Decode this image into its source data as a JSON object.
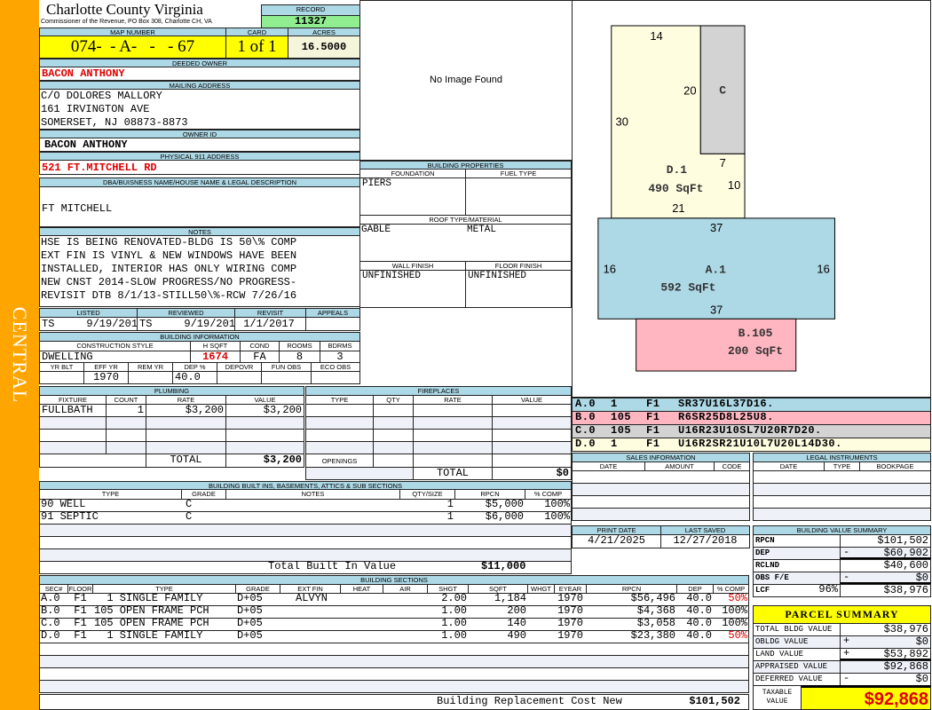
{
  "sidebar_label": "CENTRAL",
  "header": {
    "county": "Charlotte County Virginia",
    "subtitle": "Commissioner of the Revenue, PO Box 308, Charlotte CH, VA",
    "record_label": "RECORD",
    "record": "11327"
  },
  "parcel": {
    "map_number_label": "MAP NUMBER",
    "map_number": "074-  - A-   -   - 67",
    "card_label": "CARD",
    "card": "1 of 1",
    "acres_label": "ACRES",
    "acres": "16.5000"
  },
  "owner": {
    "deeded_label": "DEEDED OWNER",
    "deeded": "BACON ANTHONY",
    "mailing_label": "MAILING ADDRESS",
    "mailing": [
      "C/O DOLORES MALLORY",
      "161 IRVINGTON AVE",
      "SOMERSET, NJ 08873-8873"
    ],
    "owner_id_label": "OWNER ID",
    "owner_id": "BACON ANTHONY",
    "physical_label": "PHYSICAL 911 ADDRESS",
    "physical": "521 FT.MITCHELL RD"
  },
  "dba": {
    "label": "DBA/BUISNESS NAME/HOUSE NAME & LEGAL DESCRIPTION",
    "value": "FT MITCHELL"
  },
  "notes": {
    "label": "NOTES",
    "lines": [
      "HSE IS BEING RENOVATED-BLDG IS 50\\% COMP",
      "EXT FIN IS VINYL & NEW WINDOWS HAVE BEEN",
      "INSTALLED, INTERIOR HAS ONLY WIRING COMP",
      "NEW CNST 2014-SLOW PROGRESS/NO PROGRESS-",
      "REVISIT DTB 8/1/13-STILL50\\%-RCW 7/26/16"
    ]
  },
  "review": {
    "headers": [
      "LISTED",
      "REVIEWED",
      "REVISIT",
      "APPEALS"
    ],
    "values": [
      "TS     9/19/2018",
      "TS     9/19/2018",
      " 1/1/2017",
      ""
    ]
  },
  "building_info": {
    "label": "BUILDING INFORMATION",
    "headers1": [
      "CONSTRUCTION STYLE",
      "H SQFT",
      "COND",
      "ROOMS",
      "BDRMS"
    ],
    "values1": [
      "DWELLING",
      "1674",
      "FA",
      "8",
      "3"
    ],
    "headers2": [
      "YR BLT",
      "EFF YR",
      "REM YR",
      "DEP %",
      "DEPOVR",
      "FUN OBS",
      "ECO OBS"
    ],
    "values2": [
      "",
      "1970",
      "",
      "40.0",
      "",
      "",
      ""
    ]
  },
  "image": {
    "placeholder": "No Image Found"
  },
  "building_properties": {
    "label": "BUILDING PROPERTIES",
    "foundation_label": "FOUNDATION",
    "foundation": "PIERS",
    "fuel_label": "FUEL TYPE",
    "fuel": "",
    "roof_label": "ROOF TYPE/MATERIAL",
    "roof_type": "GABLE",
    "roof_material": "METAL",
    "wall_label": "WALL FINISH",
    "wall": "UNFINISHED",
    "floor_label": "FLOOR FINISH",
    "floor": "UNFINISHED"
  },
  "plumbing": {
    "label": "PLUMBING",
    "headers": [
      "FIXTURE",
      "COUNT",
      "RATE",
      "VALUE"
    ],
    "rows": [
      [
        "FULLBATH",
        "1",
        "$3,200",
        "$3,200"
      ],
      [
        "",
        "",
        "",
        ""
      ],
      [
        "",
        "",
        "",
        ""
      ],
      [
        "",
        "",
        "",
        ""
      ]
    ],
    "total_label": "TOTAL",
    "total": "$3,200"
  },
  "fireplaces": {
    "label": "FIREPLACES",
    "headers": [
      "TYPE",
      "QTY",
      "RATE",
      "VALUE"
    ],
    "rows": [
      [
        "",
        "",
        "",
        ""
      ],
      [
        "",
        "",
        "",
        ""
      ],
      [
        "",
        "",
        "",
        ""
      ],
      [
        "",
        "",
        "",
        ""
      ]
    ],
    "openings_label": "OPENINGS",
    "total_label": "TOTAL",
    "total": "$0"
  },
  "built_ins": {
    "label": "BUILDING BUILT INS, BASEMENTS, ATTICS & SUB SECTIONS",
    "headers": [
      "TYPE",
      "GRADE",
      "NOTES",
      "QTY/SIZE",
      "RPCN",
      "% COMP"
    ],
    "rows": [
      [
        "90 WELL",
        "C",
        "",
        "1",
        "$5,000",
        "100%"
      ],
      [
        "91 SEPTIC",
        "C",
        "",
        "1",
        "$6,000",
        "100%"
      ],
      [
        "",
        "",
        "",
        "",
        "",
        ""
      ],
      [
        "",
        "",
        "",
        "",
        "",
        ""
      ],
      [
        "",
        "",
        "",
        "",
        "",
        ""
      ]
    ],
    "total_label": "Total Built In Value",
    "total": "$11,000"
  },
  "sections": {
    "label": "BUILDING SECTIONS",
    "headers": [
      "SEC#",
      "FLOOR",
      "TYPE",
      "GRADE",
      "EXT FIN",
      "HEAT",
      "AIR",
      "SHGT",
      "SQFT",
      "WHGT",
      "EYEAR",
      "RPCN",
      "DEP",
      "% COMP"
    ],
    "rows": [
      [
        "A.0",
        "F1",
        "  1 SINGLE FAMILY",
        "D+05",
        "ALVYN",
        "",
        "",
        "2.00",
        "1,184",
        "",
        "1970",
        "$56,496",
        "40.0",
        "50%"
      ],
      [
        "B.0",
        "F1",
        "105 OPEN FRAME PCH",
        "D+05",
        "",
        "",
        "",
        "1.00",
        "200",
        "",
        "1970",
        "$4,368",
        "40.0",
        "100%"
      ],
      [
        "C.0",
        "F1",
        "105 OPEN FRAME PCH",
        "D+05",
        "",
        "",
        "",
        "1.00",
        "140",
        "",
        "1970",
        "$3,058",
        "40.0",
        "100%"
      ],
      [
        "D.0",
        "F1",
        "  1 SINGLE FAMILY",
        "D+05",
        "",
        "",
        "",
        "1.00",
        "490",
        "",
        "1970",
        "$23,380",
        "40.0",
        "50%"
      ],
      [
        "",
        "",
        "",
        "",
        "",
        "",
        "",
        "",
        "",
        "",
        "",
        "",
        "",
        ""
      ],
      [
        "",
        "",
        "",
        "",
        "",
        "",
        "",
        "",
        "",
        "",
        "",
        "",
        "",
        ""
      ],
      [
        "",
        "",
        "",
        "",
        "",
        "",
        "",
        "",
        "",
        "",
        "",
        "",
        "",
        ""
      ],
      [
        "",
        "",
        "",
        "",
        "",
        "",
        "",
        "",
        "",
        "",
        "",
        "",
        "",
        ""
      ]
    ],
    "total_label": "Building Replacement Cost New",
    "total": "$101,502"
  },
  "sketch": {
    "areas": [
      {
        "label": "A.1",
        "sqft": "592 SqFt",
        "color": "#add8e6"
      },
      {
        "label": "B.105",
        "sqft": "200 SqFt",
        "color": "#ffb6c1"
      },
      {
        "label": "C",
        "sqft": "",
        "color": "#d3d3d3"
      },
      {
        "label": "D.1",
        "sqft": "490 SqFt",
        "color": "#fffde0"
      }
    ],
    "dims": [
      "14",
      "20",
      "30",
      "7",
      "10",
      "21",
      "37",
      "16",
      "16",
      "37"
    ]
  },
  "sketch_codes": [
    [
      "A.0",
      "1",
      "F1",
      "SR37U16L37D16."
    ],
    [
      "B.0",
      "105",
      "F1",
      "R6SR25D8L25U8."
    ],
    [
      "C.0",
      "105",
      "F1",
      "U16R23U10SL7U20R7D20."
    ],
    [
      "D.0",
      "1",
      "F1",
      "U16R2SR21U10L7U20L14D30."
    ]
  ],
  "sales": {
    "label": "SALES INFORMATION",
    "headers": [
      "DATE",
      "AMOUNT",
      "CODE"
    ]
  },
  "legal": {
    "label": "LEGAL INSTRUMENTS",
    "headers": [
      "DATE",
      "TYPE",
      "BOOKPAGE"
    ]
  },
  "dates": {
    "print_label": "PRINT DATE",
    "print": "4/21/2025",
    "saved_label": "LAST SAVED",
    "saved": "12/27/2018"
  },
  "value_summary": {
    "label": "BUILDING VALUE SUMMARY",
    "rows": [
      [
        "RPCN",
        "",
        "",
        "$101,502"
      ],
      [
        "DEP",
        "",
        "-",
        "$60,902"
      ],
      [
        "RCLND",
        "",
        "",
        "$40,600"
      ],
      [
        "OBS F/E",
        "",
        "-",
        "$0"
      ],
      [
        "LCF",
        "96%",
        "",
        "$38,976"
      ]
    ]
  },
  "parcel_summary": {
    "label": "PARCEL SUMMARY",
    "rows": [
      [
        "TOTAL BLDG VALUE",
        "",
        "$38,976"
      ],
      [
        "OBLDG VALUE",
        "+",
        "$0"
      ],
      [
        "LAND VALUE",
        "+",
        "$53,892"
      ],
      [
        "APPRAISED VALUE",
        "",
        "$92,868"
      ],
      [
        "DEFERRED VALUE",
        "-",
        "$0"
      ]
    ],
    "taxable_label": "TAXABLE\nVALUE",
    "taxable": "$92,868"
  },
  "colors": {
    "sidebar": "#ffa500",
    "header": "#add8e6",
    "record": "#90ee90",
    "highlight": "#ffff00",
    "emphasis": "#e00000"
  }
}
